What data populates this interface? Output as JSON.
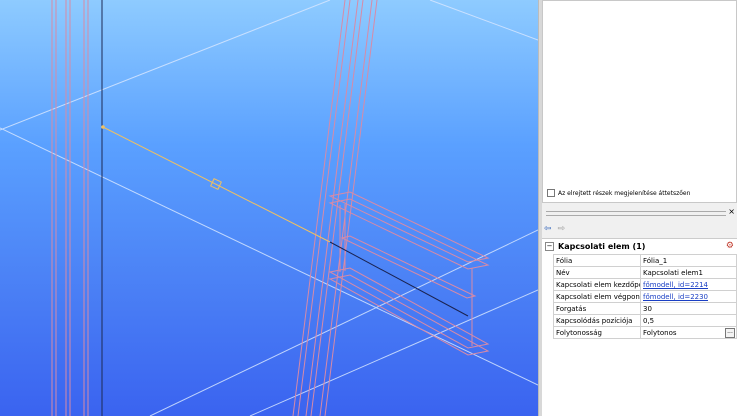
{
  "panel": {
    "hidden_parts_label": "Az elrejtett részek megjelenítése áttetszően",
    "hidden_parts_checked": false,
    "close_glyph": "×"
  },
  "nav": {
    "back_glyph": "⇦",
    "forward_glyph": "⇨"
  },
  "properties": {
    "group_title": "Kapcsolati elem (1)",
    "collapse_glyph": "−",
    "rows": [
      {
        "label": "Fólia",
        "value": "Fólia_1",
        "link": false
      },
      {
        "label": "Név",
        "value": "Kapcsolati elem1",
        "link": false
      },
      {
        "label": "Kapcsolati elem kezdőpc",
        "value": "főmodell, id=2214",
        "link": true
      },
      {
        "label": "Kapcsolati elem végpont",
        "value": "főmodell, id=2230",
        "link": true
      },
      {
        "label": "Forgatás",
        "value": "30",
        "link": false
      },
      {
        "label": "Kapcsolódás pozíciója",
        "value": "0,5",
        "link": false
      },
      {
        "label": "Folytonosság",
        "value": "Folytonos",
        "link": false
      }
    ],
    "ellipsis": "..."
  },
  "colors": {
    "sky_top": "#8ecbff",
    "sky_bottom": "#3a63f0",
    "member_outline": "#d88aa6",
    "connection_line": "#f0c060",
    "grid_line": "#cfe0ff"
  },
  "icons": [
    "back-arrow-icon",
    "forward-arrow-icon",
    "properties-icon",
    "close-icon"
  ]
}
